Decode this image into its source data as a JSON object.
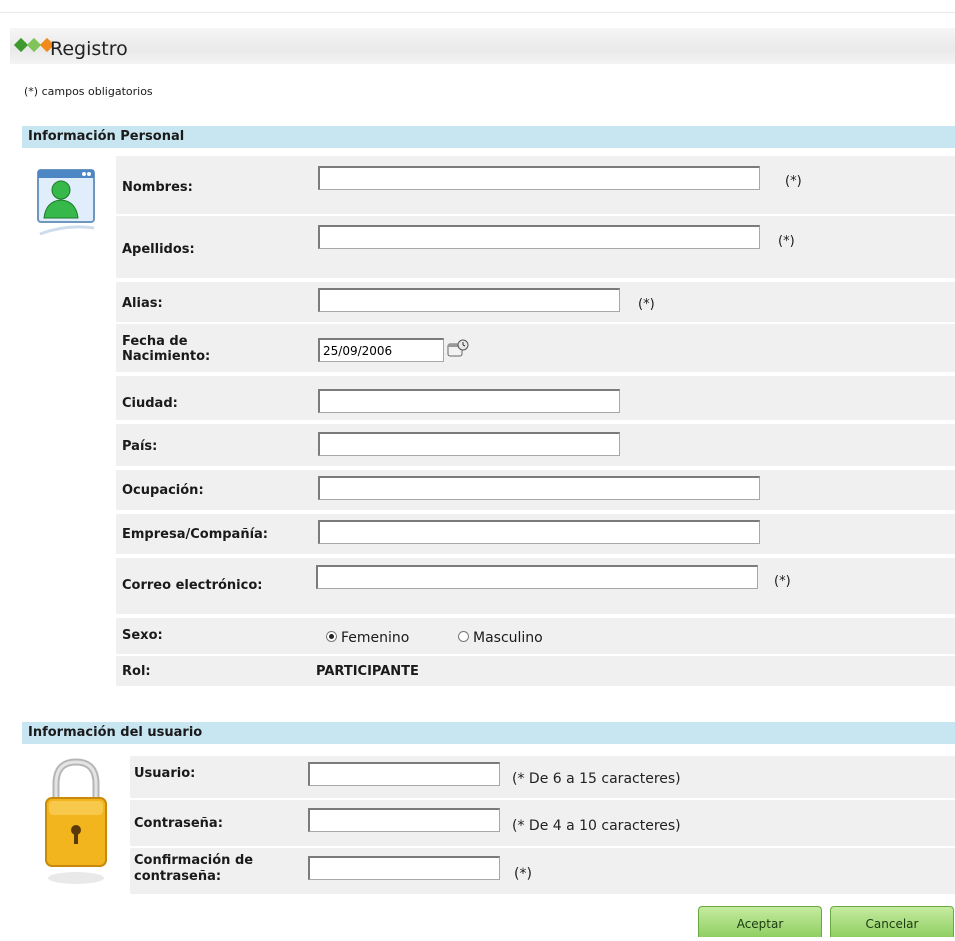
{
  "page": {
    "title": "Registro",
    "required_note": "(*) campos obligatorios",
    "required_mark": "(*)"
  },
  "personal": {
    "header": "Información Personal",
    "fields": {
      "nombres": {
        "label": "Nombres:",
        "value": ""
      },
      "apellidos": {
        "label": "Apellidos:",
        "value": ""
      },
      "alias": {
        "label": "Alias:",
        "value": ""
      },
      "fecha_line1": "Fecha de",
      "fecha_line2": "Nacimiento:",
      "fecha_value": "25/09/2006",
      "ciudad": {
        "label": "Ciudad:",
        "value": ""
      },
      "pais": {
        "label": "País:",
        "value": ""
      },
      "ocupacion": {
        "label": "Ocupación:",
        "value": ""
      },
      "empresa": {
        "label": "Empresa/Compañía:",
        "value": ""
      },
      "correo": {
        "label": "Correo electrónico:",
        "value": ""
      },
      "sexo": {
        "label": "Sexo:",
        "options": [
          "Femenino",
          "Masculino"
        ],
        "selected": "Femenino"
      },
      "rol": {
        "label": "Rol:",
        "value": "PARTICIPANTE"
      }
    }
  },
  "user": {
    "header": "Información del usuario",
    "usuario": {
      "label": "Usuario:",
      "hint": "(* De 6 a 15 caracteres)",
      "value": ""
    },
    "contrasena": {
      "label": "Contraseña:",
      "hint": "(* De 4 a 10 caracteres)",
      "value": ""
    },
    "confirm_line1": "Confirmación de",
    "confirm_line2": "contraseña:",
    "confirm_hint": "(*)"
  },
  "buttons": {
    "accept": "Aceptar",
    "cancel": "Cancelar"
  },
  "icons": {
    "personal": "user-profile-icon",
    "user": "padlock-icon",
    "calendar": "calendar-picker-icon"
  }
}
